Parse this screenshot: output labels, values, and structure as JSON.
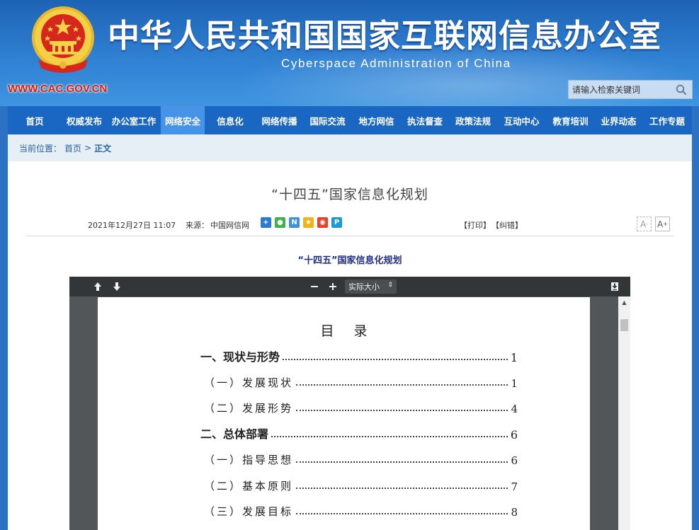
{
  "header": {
    "title": "中华人民共和国国家互联网信息办公室",
    "subtitle": "Cyberspace Administration of China",
    "url": "WWW.CAC.GOV.CN",
    "search_placeholder": "请输入检索关键词"
  },
  "nav": {
    "items": [
      {
        "label": "首页",
        "active": false
      },
      {
        "label": "权威发布",
        "active": false
      },
      {
        "label": "办公室工作",
        "active": false
      },
      {
        "label": "网络安全",
        "active": true
      },
      {
        "label": "信息化",
        "active": false
      },
      {
        "label": "网络传播",
        "active": false
      },
      {
        "label": "国际交流",
        "active": false
      },
      {
        "label": "地方网信",
        "active": false
      },
      {
        "label": "执法督查",
        "active": false
      },
      {
        "label": "政策法规",
        "active": false
      },
      {
        "label": "互动中心",
        "active": false
      },
      {
        "label": "教育培训",
        "active": false
      },
      {
        "label": "业界动态",
        "active": false
      },
      {
        "label": "工作专题",
        "active": false
      }
    ]
  },
  "breadcrumb": {
    "prefix": "当前位置：",
    "home": "首页",
    "separator": ">",
    "current": "正文"
  },
  "article": {
    "title": "“十四五”国家信息化规划",
    "date": "2021年12月27日 11:07",
    "source_label": "来源：",
    "source": "中国网信网",
    "print": "【打印】",
    "report": "【纠错】",
    "font_small": "A",
    "font_large": "A",
    "font_small_sign": "-",
    "font_large_sign": "+",
    "doc_heading": "“十四五”国家信息化规划"
  },
  "pdf": {
    "zoom": "实际大小",
    "toc_title": "目录",
    "toc": [
      {
        "label": "一、现状与形势",
        "page": "1",
        "level": 1
      },
      {
        "label": "（一）发展现状",
        "page": "1",
        "level": 2
      },
      {
        "label": "（二）发展形势",
        "page": "4",
        "level": 2
      },
      {
        "label": "二、总体部署",
        "page": "6",
        "level": 1
      },
      {
        "label": "（一）指导思想",
        "page": "6",
        "level": 2
      },
      {
        "label": "（二）基本原则",
        "page": "7",
        "level": 2
      },
      {
        "label": "（三）发展目标",
        "page": "8",
        "level": 2
      }
    ]
  },
  "colors": {
    "header_blue": "#2f80d3",
    "nav_blue": "#1a66c3",
    "nav_active": "#4694e8",
    "url_red": "#d81e06",
    "link_blue": "#2a62a6"
  }
}
